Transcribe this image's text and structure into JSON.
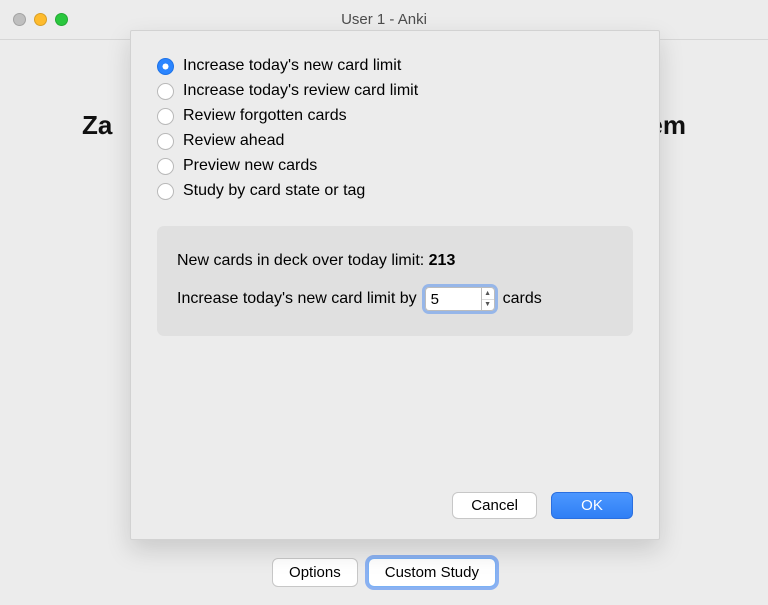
{
  "window": {
    "title": "User 1 - Anki"
  },
  "background_page": {
    "heading_left_fragment": "Za",
    "heading_right_fragment": "em",
    "options_button": "Options",
    "custom_study_button": "Custom Study"
  },
  "dialog": {
    "options": [
      "Increase today's new card limit",
      "Increase today's review card limit",
      "Review forgotten cards",
      "Review ahead",
      "Preview new cards",
      "Study by card state or tag"
    ],
    "selected_index": 0,
    "info": {
      "line1_prefix": "New cards in deck over today limit: ",
      "line1_value": "213",
      "line2_prefix": "Increase today's new card limit by",
      "spin_value": "5",
      "line2_suffix": "cards"
    },
    "cancel": "Cancel",
    "ok": "OK"
  }
}
